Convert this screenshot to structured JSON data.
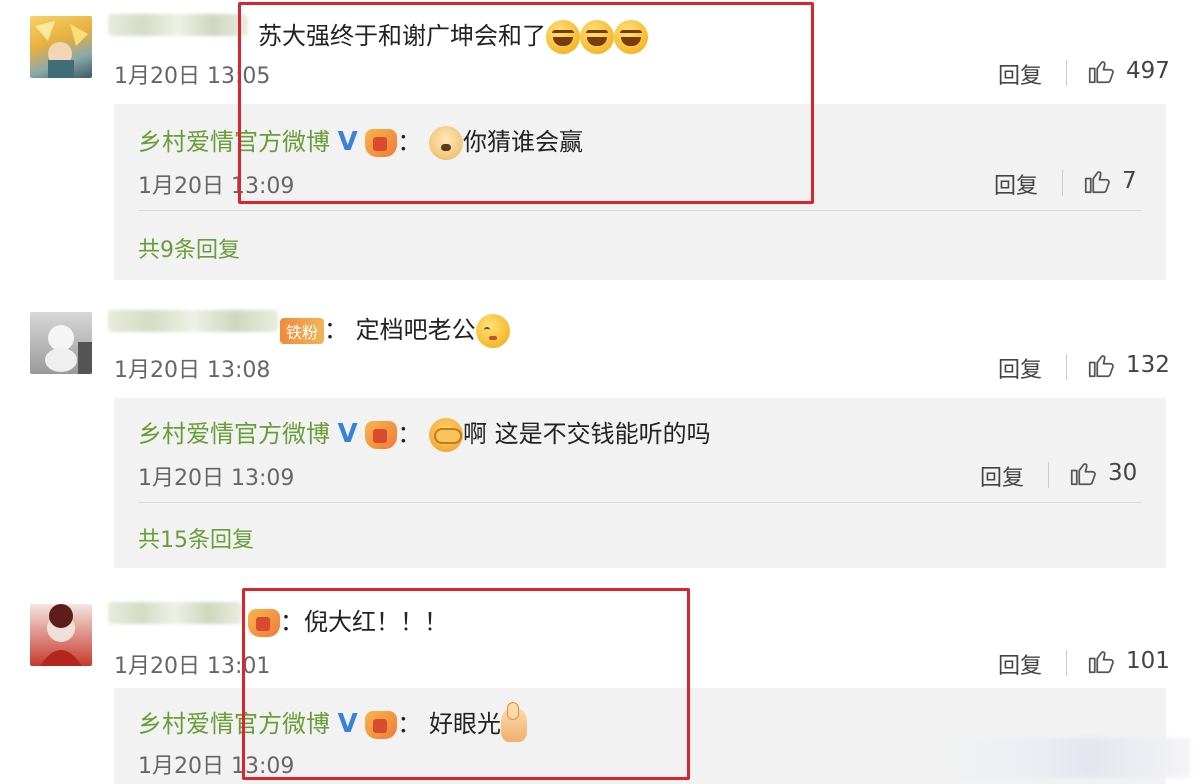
{
  "colors": {
    "author": "#6a9d3a",
    "highlight": "#d9262c",
    "reply_bg": "#f2f2f2"
  },
  "icons": {
    "like": "thumbs-up-icon",
    "verified": "verified-v-icon",
    "fan_badge": "fan-badge-icon"
  },
  "comments": [
    {
      "text": "苏大强终于和谢广坤会和了",
      "time": "1月20日 13:05",
      "reply_label": "回复",
      "likes": "497",
      "official_reply": {
        "author": "乡村爱情官方微博",
        "verified": "V",
        "colon": "：",
        "text": "你猜谁会赢",
        "time": "1月20日 13:09",
        "reply_label": "回复",
        "likes": "7"
      },
      "more_replies": "共9条回复"
    },
    {
      "badge": "铁粉",
      "colon": "：",
      "text": "定档吧老公",
      "time": "1月20日 13:08",
      "reply_label": "回复",
      "likes": "132",
      "official_reply": {
        "author": "乡村爱情官方微博",
        "verified": "V",
        "colon": "：",
        "text": "啊 这是不交钱能听的吗",
        "time": "1月20日 13:09",
        "reply_label": "回复",
        "likes": "30"
      },
      "more_replies": "共15条回复"
    },
    {
      "colon": "：",
      "text": "倪大红！！！",
      "time": "1月20日 13:01",
      "reply_label": "回复",
      "likes": "101",
      "official_reply": {
        "author": "乡村爱情官方微博",
        "verified": "V",
        "colon": "：",
        "text": "好眼光",
        "time": "1月20日 13:09"
      }
    }
  ]
}
